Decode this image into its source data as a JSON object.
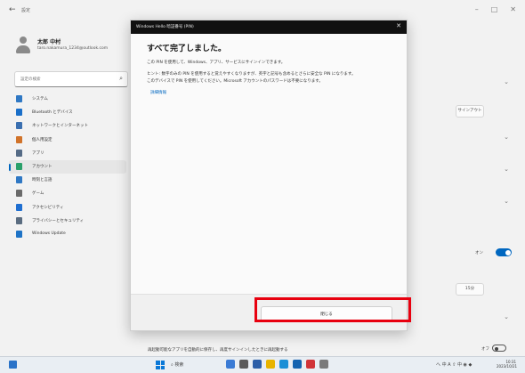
{
  "window": {
    "title": "設定"
  },
  "profile": {
    "name": "太郎 中村",
    "email": "taro.nakamura_1234@outlook.com"
  },
  "search": {
    "placeholder": "設定の検索"
  },
  "sidebar": {
    "items": [
      {
        "label": "システム",
        "icon": "system-icon",
        "color": "#2f78c4",
        "selected": false
      },
      {
        "label": "Bluetooth とデバイス",
        "icon": "bluetooth-icon",
        "color": "#1a6fc9",
        "selected": false
      },
      {
        "label": "ネットワークとインターネット",
        "icon": "network-icon",
        "color": "#3a6fb0",
        "selected": false
      },
      {
        "label": "個人用設定",
        "icon": "brush-icon",
        "color": "#d1732a",
        "selected": false
      },
      {
        "label": "アプリ",
        "icon": "apps-icon",
        "color": "#556b86",
        "selected": false
      },
      {
        "label": "アカウント",
        "icon": "accounts-icon",
        "color": "#2aa06a",
        "selected": true
      },
      {
        "label": "時刻と言語",
        "icon": "time-language-icon",
        "color": "#2f78c4",
        "selected": false
      },
      {
        "label": "ゲーム",
        "icon": "gaming-icon",
        "color": "#6a6a6a",
        "selected": false
      },
      {
        "label": "アクセシビリティ",
        "icon": "accessibility-icon",
        "color": "#1f6fd1",
        "selected": false
      },
      {
        "label": "プライバシーとセキュリティ",
        "icon": "privacy-icon",
        "color": "#5a6c80",
        "selected": false
      },
      {
        "label": "Windows Update",
        "icon": "update-icon",
        "color": "#1e73c6",
        "selected": false
      }
    ]
  },
  "content": {
    "manage_label": "サインアウト",
    "select_value": "15分",
    "toggle_label": "オン",
    "footer_text": "再起動可能なアプリを自動的に保存し、再度サインインしたときに再起動する",
    "footer_toggle_label": "オフ"
  },
  "dialog": {
    "title": "Windows Hello 暗証番号 (PIN)",
    "heading": "すべて完了しました。",
    "line1": "この PIN を使用して、Windows、アプリ、サービスにサインインできます。",
    "line2": "ヒント: 数字のみの PIN を使用すると覚えやすくなりますが、英字と記号も含めるとさらに安全な PIN になります。",
    "line3": "このデバイスで PIN を使用してください。Microsoft アカウントのパスワードは不要になります。",
    "link": "詳細情報",
    "close_label": "閉じる"
  },
  "taskbar": {
    "search_label": "検索",
    "tray": "へ 中 A ⇧ 中 ◉ ◆",
    "time": "10:31",
    "date": "2023/10/21"
  }
}
